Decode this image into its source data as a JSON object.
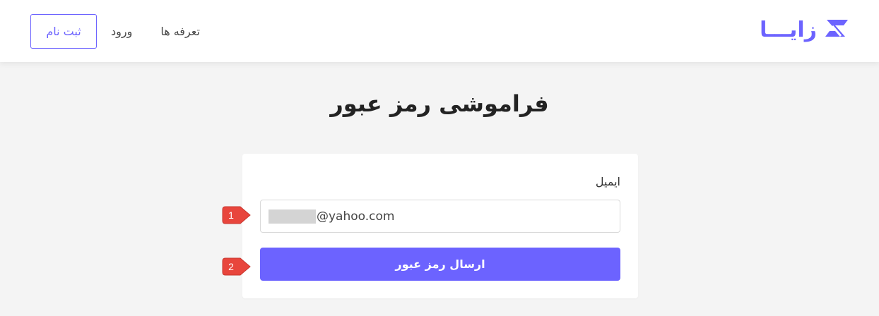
{
  "header": {
    "logo_text": "زایـــا",
    "nav": {
      "pricing": "تعرفه ها",
      "login": "ورود",
      "register": "ثبت نام"
    }
  },
  "page": {
    "title": "فراموشی رمز عبور"
  },
  "form": {
    "email_label": "ایمیل",
    "email_value_visible": "@yahoo.com",
    "submit_label": "ارسال رمز عبور"
  },
  "annotations": {
    "marker_1": "1",
    "marker_2": "2"
  },
  "colors": {
    "brand": "#6c63ff",
    "background": "#f4f4f4",
    "marker": "#e8453c"
  },
  "icons": {
    "logo": "zaya-logo-icon",
    "marker": "callout-arrow-icon"
  }
}
